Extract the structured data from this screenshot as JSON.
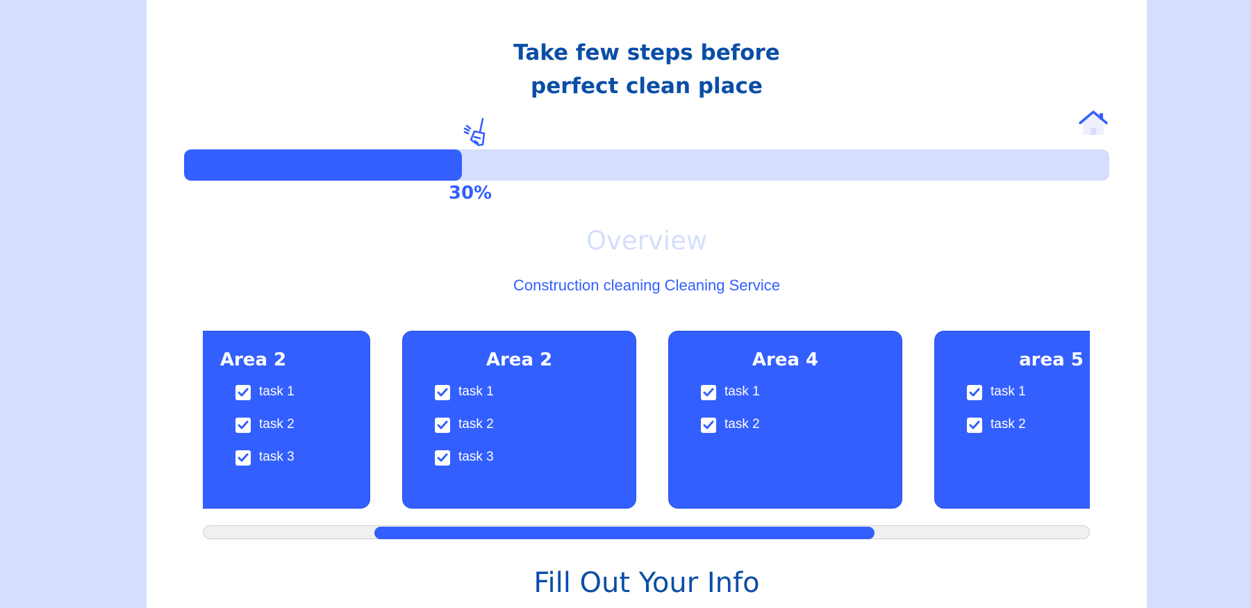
{
  "header": {
    "title_line1": "Take few steps before",
    "title_line2": "perfect clean place"
  },
  "progress": {
    "value": 0.3,
    "label": "30%",
    "start_icon": "broom-icon",
    "end_icon": "house-icon"
  },
  "overview": {
    "heading": "Overview",
    "service": "Construction cleaning Cleaning Service"
  },
  "areas": [
    {
      "title": "Area 2",
      "tasks": [
        "task 1",
        "task 2",
        "task 3"
      ]
    },
    {
      "title": "Area 2",
      "tasks": [
        "task 1",
        "task 2",
        "task 3"
      ]
    },
    {
      "title": "Area 4",
      "tasks": [
        "task 1",
        "task 2"
      ]
    },
    {
      "title": "area 5",
      "tasks": [
        "task 1",
        "task 2"
      ]
    }
  ],
  "info": {
    "heading": "Fill Out Your Info"
  },
  "colors": {
    "accent": "#335fff",
    "heading": "#0a4ea6",
    "light": "#d5defc"
  }
}
